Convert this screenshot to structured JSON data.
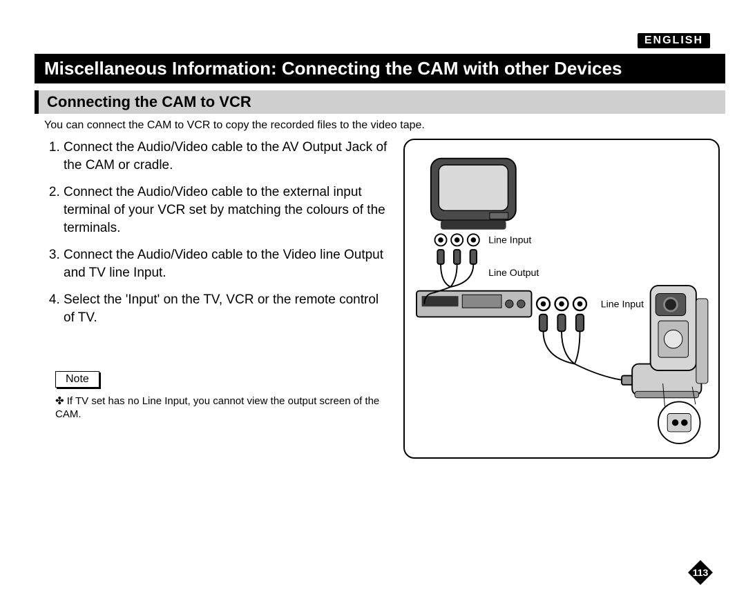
{
  "lang_tag": "ENGLISH",
  "title": "Miscellaneous Information: Connecting the CAM with other Devices",
  "subtitle": "Connecting the CAM to VCR",
  "intro": "You can connect the CAM to VCR to copy the recorded files to the video tape.",
  "steps": [
    "Connect the Audio/Video cable to the AV Output Jack of the CAM or cradle.",
    "Connect the Audio/Video cable to the external input terminal of your VCR set by matching the colours of the terminals.",
    "Connect the Audio/Video cable to the Video line Output and TV line Input.",
    "Select the 'Input' on the TV, VCR or the remote control of TV."
  ],
  "note_label": "Note",
  "note_body": "If TV set has no Line Input, you cannot view the output screen of the CAM.",
  "diagram": {
    "label_line_input_top": "Line Input",
    "label_line_output": "Line Output",
    "label_line_input_right": "Line Input"
  },
  "page_number": "113"
}
